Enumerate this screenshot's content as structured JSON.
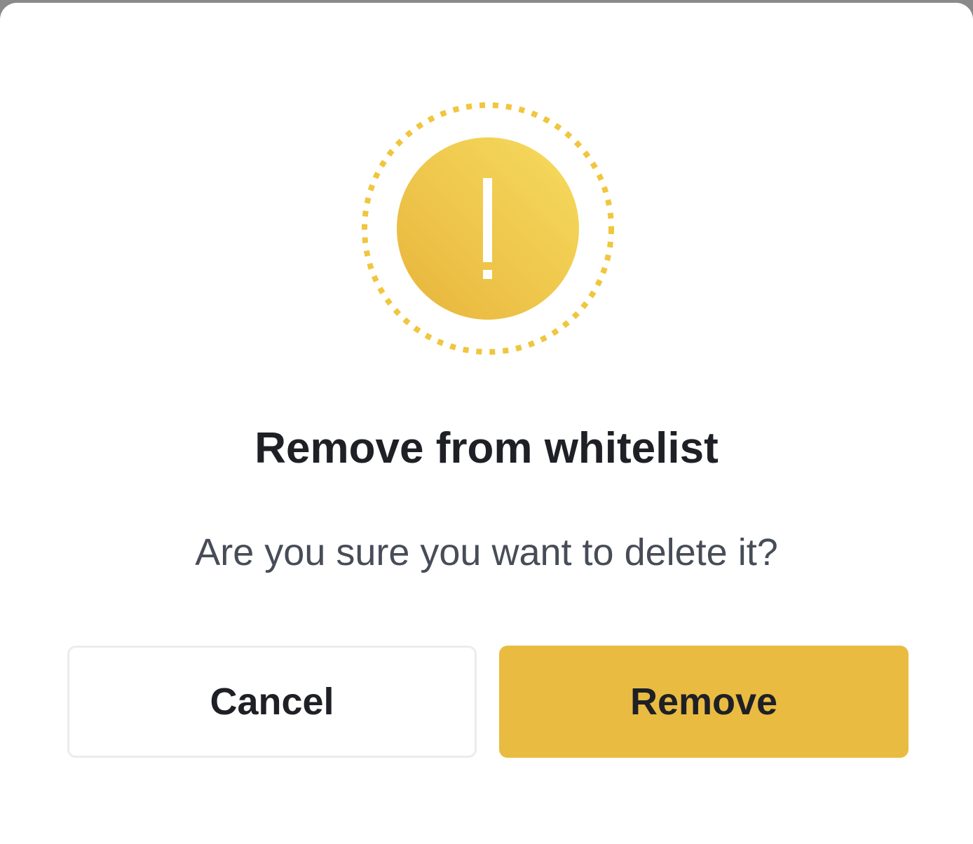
{
  "dialog": {
    "icon": "warning-exclamation-icon",
    "title": "Remove from whitelist",
    "message": "Are you sure you want to delete it?",
    "cancel_label": "Cancel",
    "confirm_label": "Remove"
  },
  "colors": {
    "accent": "#e9bb41",
    "icon_light": "#f4d75a",
    "icon_dark": "#e9b63c",
    "title_text": "#1e2026",
    "message_text": "#474d57",
    "cancel_border": "#eaecef"
  }
}
